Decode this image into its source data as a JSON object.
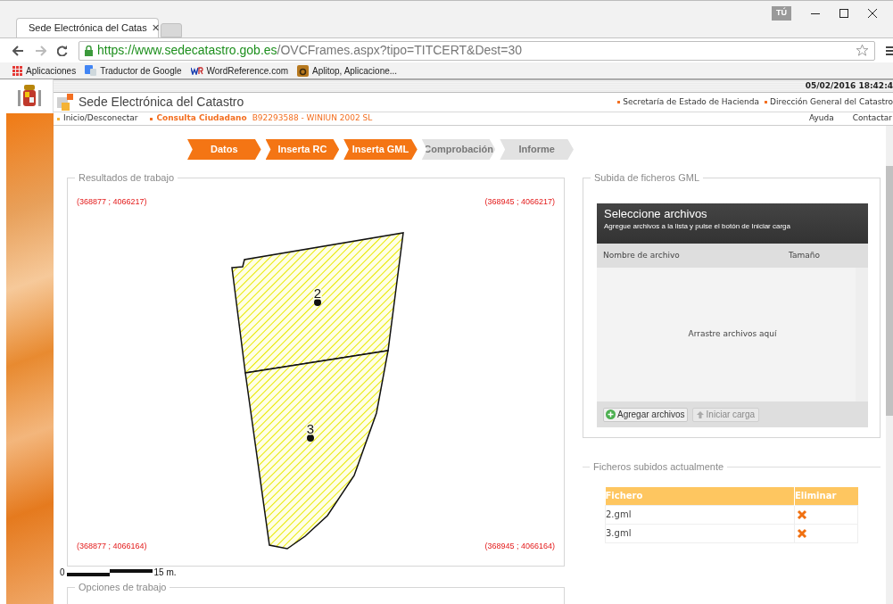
{
  "browser": {
    "tab_title": "Sede Electrónica del Catas",
    "tab_close": "✕",
    "profile_badge": "TÚ",
    "url_host": "https://www.sedecatastro.gob.es",
    "url_path": "/OVCFrames.aspx?tipo=TITCERT&Dest=30",
    "bookmarks": [
      {
        "label": "Aplicaciones",
        "kind": "apps"
      },
      {
        "label": "Traductor de Google",
        "kind": "translate"
      },
      {
        "label": "WordReference.com",
        "kind": "wr"
      },
      {
        "label": "Aplitop, Aplicacione...",
        "kind": "aplitop"
      }
    ]
  },
  "header": {
    "datetime": "05/02/2016 18:42:4",
    "site_title": "Sede Electrónica del Catastro",
    "top_links": [
      "Secretaría de Estado de Hacienda",
      "Dirección General del Catastro"
    ],
    "nav_left": "Inicio/Desconectar",
    "user_section": "Consulta Ciudadano",
    "user_id": "B92293588 - WINIUN 2002 SL",
    "nav_right": [
      "Ayuda",
      "Contactar"
    ]
  },
  "steps": [
    {
      "label": "Datos",
      "done": true
    },
    {
      "label": "Inserta RC",
      "done": true
    },
    {
      "label": "Inserta GML",
      "done": true
    },
    {
      "label": "Comprobación",
      "done": false
    },
    {
      "label": "Informe",
      "done": false
    }
  ],
  "results": {
    "legend": "Resultados de trabajo",
    "corner_top_left": "(368877 ; 4066217)",
    "corner_top_right": "(368945 ; 4066217)",
    "corner_bottom_left": "(368877 ; 4066164)",
    "corner_bottom_right": "(368945 ; 4066164)",
    "parcels": [
      {
        "label": "2"
      },
      {
        "label": "3"
      }
    ],
    "scale_start": "0",
    "scale_end": "15 m."
  },
  "options_legend": "Opciones de trabajo",
  "upload": {
    "legend": "Subida de ficheros GML",
    "title": "Seleccione archivos",
    "subtitle": "Agregue archivos a la lista y pulse el botón de Iniciar carga",
    "col_name": "Nombre de archivo",
    "col_size": "Tamaño",
    "drop_hint": "Arrastre archivos aquí",
    "add_button": "Agregar archivos",
    "start_button": "Iniciar carga"
  },
  "uploaded": {
    "legend": "Ficheros subidos actualmente",
    "columns": [
      "Fichero",
      "Eliminar"
    ],
    "rows": [
      {
        "file": "2.gml"
      },
      {
        "file": "3.gml"
      }
    ]
  }
}
